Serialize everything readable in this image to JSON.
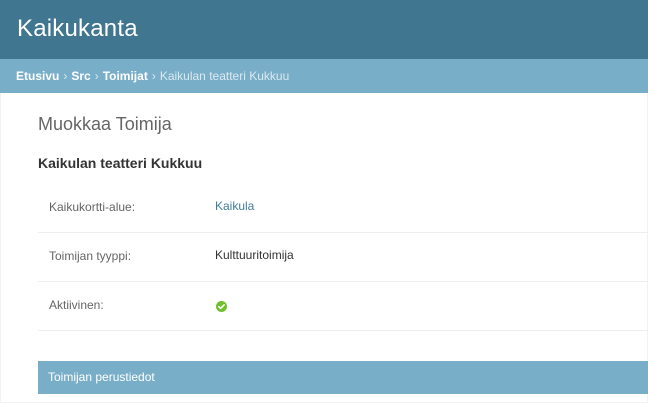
{
  "header": {
    "title": "Kaikukanta"
  },
  "breadcrumbs": {
    "items": [
      "Etusivu",
      "Src",
      "Toimijat"
    ],
    "separator": "›",
    "current": "Kaikulan teatteri Kukkuu"
  },
  "page": {
    "title": "Muokkaa Toimija",
    "object_name": "Kaikulan teatteri Kukkuu"
  },
  "fields": [
    {
      "label": "Kaikukortti-alue:",
      "value": "Kaikula",
      "is_link": true
    },
    {
      "label": "Toimijan tyyppi:",
      "value": "Kulttuuritoimija",
      "is_link": false
    },
    {
      "label": "Aktiivinen:",
      "value_icon": "check-icon",
      "active": true
    }
  ],
  "fieldset": {
    "title": "Toimijan perustiedot"
  },
  "colors": {
    "header": "#417690",
    "breadcrumb_bar": "#79aec8",
    "link": "#447e9b",
    "success": "#70bf2b"
  }
}
